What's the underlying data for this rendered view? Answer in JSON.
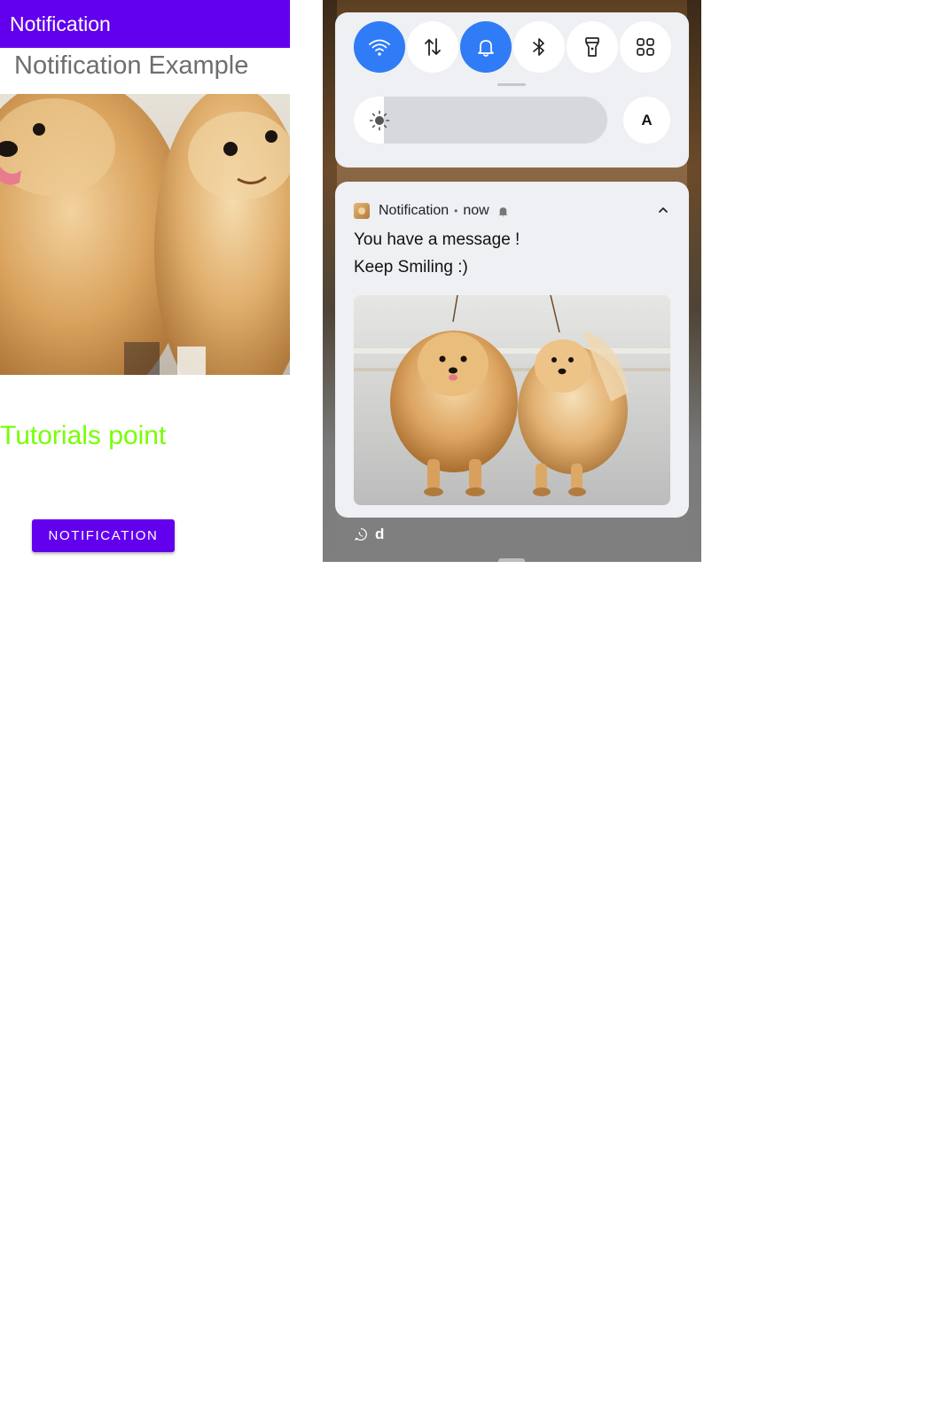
{
  "app": {
    "app_bar_title": "Notification",
    "heading": "Notification Example",
    "brand_text": "Tutorials point",
    "button_label": "NOTIFICATION",
    "colors": {
      "primary": "#6200ee",
      "brand_text": "#76ff03",
      "heading_text": "#6e6e6e"
    },
    "photo_subject": "two pomeranian dogs"
  },
  "quick_settings": {
    "tiles": [
      {
        "name": "wifi",
        "icon": "wifi-icon",
        "active": true
      },
      {
        "name": "mobile-data",
        "icon": "data-arrows-icon",
        "active": false
      },
      {
        "name": "sound",
        "icon": "bell-icon",
        "active": true
      },
      {
        "name": "bluetooth",
        "icon": "bluetooth-icon",
        "active": false
      },
      {
        "name": "flashlight",
        "icon": "flashlight-icon",
        "active": false
      },
      {
        "name": "more-tiles",
        "icon": "grid-icon",
        "active": false
      }
    ],
    "brightness_level": 0.12,
    "auto_brightness_label": "A",
    "active_tile_color": "#2f7cf6"
  },
  "notification": {
    "app_name": "Notification",
    "separator": "•",
    "time": "now",
    "title": "You have a message !",
    "text": "Keep Smiling :)",
    "image_subject": "two pomeranian dogs"
  },
  "status_bar": {
    "icon": "whatsapp-icon",
    "letter": "d"
  }
}
